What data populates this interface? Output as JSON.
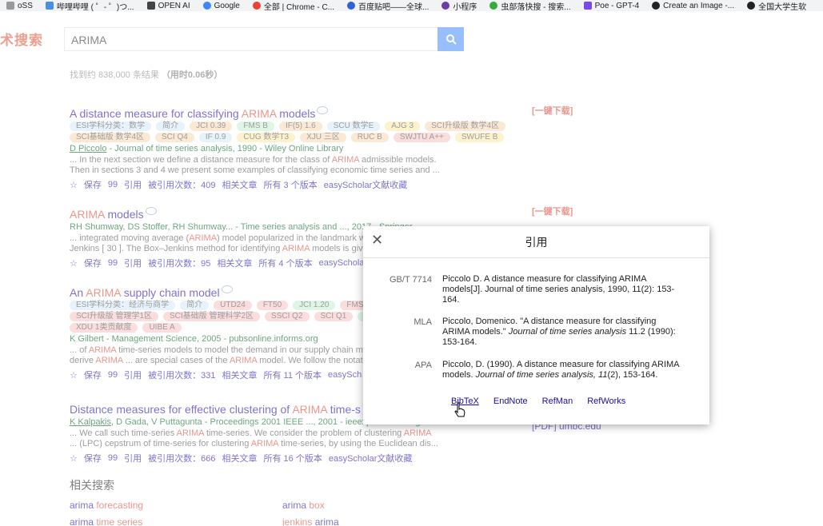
{
  "bookmarks": [
    {
      "label": "oSS",
      "color": "#555"
    },
    {
      "label": "哔哩哔哩 ( ゜- ゜)つ...",
      "color": "#4a90e2"
    },
    {
      "label": "OPEN AI",
      "color": "#222"
    },
    {
      "label": "Google",
      "color": "#4285f4"
    },
    {
      "label": "全部 | Chrome - C...",
      "color": "#e94235"
    },
    {
      "label": "百度贴吧——全球...",
      "color": "#3063d1"
    },
    {
      "label": "小程序",
      "color": "#6c3ea5"
    },
    {
      "label": "虫部落快搜 - 搜索...",
      "color": "#3aaa3a"
    },
    {
      "label": "Poe - GPT-4",
      "color": "#7b4ae0"
    },
    {
      "label": "Create an Image -...",
      "color": "#222"
    },
    {
      "label": "全国大学生软",
      "color": "#222"
    }
  ],
  "logo": "术搜索",
  "search": {
    "value": "ARIMA"
  },
  "result_count": {
    "prefix": "找到约 838,000 条结果",
    "time": "（用时0.06秒）"
  },
  "download_label": "[一键下载]",
  "results": [
    {
      "title_pre": "A distance measure for classifying ",
      "title_hl": "ARIMA",
      "title_post": " models",
      "tags": [
        {
          "text": "ESI学科分类：数学",
          "tone": "blue"
        },
        {
          "text": "简介",
          "tone": "blue"
        },
        {
          "text": "JCI 0.39",
          "tone": "orange"
        },
        {
          "text": "FMS B",
          "tone": "green"
        },
        {
          "text": "IF(5) 1.6",
          "tone": "orange"
        },
        {
          "text": "SCU 数学E",
          "tone": "blue"
        },
        {
          "text": "AJG 3",
          "tone": "yellow"
        },
        {
          "text": "SCI升级版 数学4区",
          "tone": "orange"
        },
        {
          "text": "SCI基础版 数学4区",
          "tone": "orange"
        },
        {
          "text": "SCI Q4",
          "tone": "orange"
        },
        {
          "text": "IF 0.9",
          "tone": "blue"
        },
        {
          "text": "CUG 数学T3",
          "tone": "yellow"
        },
        {
          "text": "XJU 三区",
          "tone": "orange"
        },
        {
          "text": "RUC B",
          "tone": "orange"
        },
        {
          "text": "SWJTU A++",
          "tone": "red"
        },
        {
          "text": "SWUFE B",
          "tone": "yellow"
        }
      ],
      "meta_author": "D Piccolo",
      "meta_rest": " - Journal of time series analysis, 1990 - Wiley Online Library",
      "snippet1_pre": "... In the next section we define a distance measure for the class of ",
      "snippet1_hl": "ARIMA",
      "snippet1_post": " admissible models.",
      "snippet2": "Then in sections 3 and 4 we present some examples of classifying economic time series and ...",
      "actions": [
        "☆",
        "保存",
        "99",
        "引用",
        "被引用次数：409",
        "相关文章",
        "所有 3 个版本",
        "easyScholar文献收藏"
      ]
    },
    {
      "title_hl": "ARIMA",
      "title_post": " models",
      "meta": "RH Shumway, DS Stoffer, RH Shumway... - Time series analysis and ..., 2017 - Springer",
      "snippet1_pre": "... integrated moving average (",
      "snippet1_hl": "ARIMA",
      "snippet1_post": ") model popularized in the landmark w",
      "snippet2_pre": "Jenkins [ 30 ]. The Box–Jenkins method for identifying ",
      "snippet2_hl": "ARIMA",
      "snippet2_post": " models is give",
      "actions": [
        "☆",
        "保存",
        "99",
        "引用",
        "被引用次数：95",
        "相关文章",
        "所有 4 个版本",
        "easySchola"
      ]
    },
    {
      "title_pre": "An ",
      "title_hl": "ARIMA",
      "title_post": " supply chain model",
      "tags": [
        {
          "text": "ESI学科分类：经济与商学",
          "tone": "blue"
        },
        {
          "text": "简介",
          "tone": "blue"
        },
        {
          "text": "UTD24",
          "tone": "red"
        },
        {
          "text": "FT50",
          "tone": "red"
        },
        {
          "text": "JCI 1.20",
          "tone": "green"
        },
        {
          "text": "FMS A",
          "tone": "red"
        },
        {
          "text": "IF(5) 7.1",
          "tone": "green"
        },
        {
          "text": "SCU 管理学B",
          "tone": "yellow"
        },
        {
          "text": "SCI升级版 管理学1区",
          "tone": "red"
        },
        {
          "text": "SCI基础版 管理科学2区",
          "tone": "red"
        },
        {
          "text": "SSCI Q2",
          "tone": "red"
        },
        {
          "text": "SCI Q1",
          "tone": "red"
        },
        {
          "text": "NJU A",
          "tone": "green"
        },
        {
          "text": "RUC A+",
          "tone": "red"
        },
        {
          "text": "SWJTU A++",
          "tone": "red"
        },
        {
          "text": "XDU 1类贡献度",
          "tone": "red"
        },
        {
          "text": "UIBE A",
          "tone": "red"
        }
      ],
      "meta": "K Gilbert - Management Science, 2005 - pubsonline.informs.org",
      "snippet1_pre": "... of ",
      "snippet1_hl": "ARIMA",
      "snippet1_post": " time-series models to model the demand in our supply chain mo",
      "snippet2_pre": "derive ",
      "snippet2_hl": "ARIMA",
      "snippet2_mid": " ... are special cases of the ",
      "snippet2_hl2": "ARIMA",
      "snippet2_post": " model. We follow the notati",
      "actions": [
        "☆",
        "保存",
        "99",
        "引用",
        "被引用次数：331",
        "相关文章",
        "所有 11 个版本",
        "easySch"
      ]
    },
    {
      "title_pre": "Distance measures for effective clustering of ",
      "title_hl": "ARIMA",
      "title_post": " time-s",
      "meta_author": "K Kalpakis",
      "meta_rest": ", D Gada, V Puttagunta - Proceedings 2001 IEEE ..., 2001 - ieeexplore.ieee.org",
      "snippet1_pre": "... We call such time-series ",
      "snippet1_hl": "ARIMA",
      "snippet1_mid": " time-series. We consider the problem of clustering ",
      "snippet1_hl2": "ARIMA",
      "snippet2_pre": "... (LPC) cepstrum of time-series for clustering ",
      "snippet2_hl": "ARIMA",
      "snippet2_post": " time-series, by using the Euclidean dis...",
      "actions": [
        "☆",
        "保存",
        "99",
        "引用",
        "被引用次数：666",
        "相关文章",
        "所有 16 个版本",
        "easyScholar文献收藏"
      ]
    }
  ],
  "side_link": "[PDF] umbc.edu",
  "related": {
    "title": "相关搜索",
    "items": [
      {
        "pre": "arima ",
        "hl": "forecasting"
      },
      {
        "pre": "arima ",
        "hl": "box"
      },
      {
        "pre": "arima ",
        "hl": "time series"
      },
      {
        "pre": "",
        "hl": "jenkins",
        "post": " arima"
      }
    ]
  },
  "modal": {
    "title": "引用",
    "citations": [
      {
        "label": "GB/T 7714",
        "text": "Piccolo D. A distance measure for classifying ARIMA models[J]. Journal of time series analysis, 1990, 11(2): 153-164."
      },
      {
        "label": "MLA",
        "pre": "Piccolo, Domenico. \"A distance measure for classifying ARIMA models.\" ",
        "italic": "Journal of time series analysis",
        "post": " 11.2 (1990): 153-164."
      },
      {
        "label": "APA",
        "pre": "Piccolo, D. (1990). A distance measure for classifying ARIMA models. ",
        "italic": "Journal of time series analysis, 11",
        "post": "(2), 153-164."
      }
    ],
    "links": [
      "BibTeX",
      "EndNote",
      "RefMan",
      "RefWorks"
    ]
  }
}
